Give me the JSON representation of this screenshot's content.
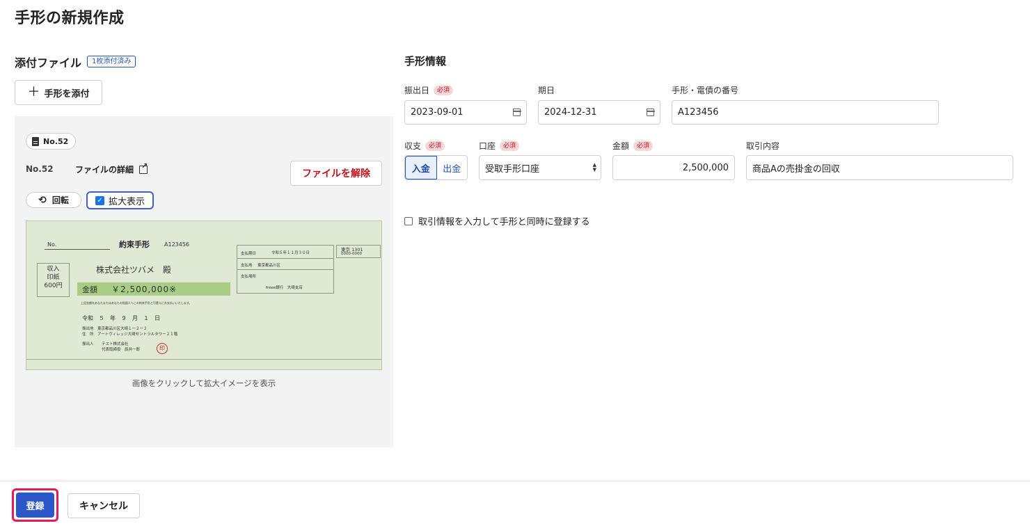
{
  "page": {
    "title": "手形の新規作成"
  },
  "attachments": {
    "section_title": "添付ファイル",
    "badge": "1枚添付済み",
    "attach_button": "手形を添付",
    "file_chip": "No.52",
    "file_no": "No.52",
    "file_detail_link": "ファイルの詳細",
    "remove_button": "ファイルを解除",
    "rotate_button": "回転",
    "zoom_label": "拡大表示",
    "zoom_checked": true,
    "caption": "画像をクリックして拡大イメージを表示",
    "note_image": {
      "no_label": "No.",
      "title": "約束手形",
      "number": "A123456",
      "payee": "株式会社ツバメ　殿",
      "stamp_box": [
        "収入",
        "印紙",
        "600円"
      ],
      "amount_label": "金額",
      "amount": "￥2,500,000※",
      "fine_print": "上記金額をあなたまたはあなたの指図人へこの約束手形と引替えにお支払いいたします。",
      "date_line": "令和　５　年　９　月　１　日",
      "issue_place": "振出地　東京都品川区大崎１ー２ー２",
      "address": "住　所　アートヴィレッジ大崎セントラルタワー２１階",
      "issuer_label": "振出人",
      "issuer": "テスト株式会社",
      "representative": "代表取締役　辰井一郎",
      "seal": "印",
      "due_label": "支払期日",
      "due_date": "令和５年１１月３０日",
      "pay_place_label": "支払地",
      "pay_place": "東京都品川区",
      "pay_at_label": "支払場所",
      "bank": "freee銀行　大崎支店",
      "corner_top": "東京 1301",
      "corner_bottom": "0000-0000"
    }
  },
  "form": {
    "section_title": "手形情報",
    "required_badge": "必須",
    "issue_date": {
      "label": "振出日",
      "value": "2023-09-01"
    },
    "due_date": {
      "label": "期日",
      "value": "2024-12-31"
    },
    "note_number": {
      "label": "手形・電債の番号",
      "value": "A123456"
    },
    "direction": {
      "label": "収支",
      "options": [
        "入金",
        "出金"
      ],
      "selected": "入金"
    },
    "account": {
      "label": "口座",
      "value": "受取手形口座"
    },
    "amount": {
      "label": "金額",
      "value": "2,500,000"
    },
    "description": {
      "label": "取引内容",
      "value": "商品Aの売掛金の回収"
    },
    "register_transaction_checkbox": "取引情報を入力して手形と同時に登録する"
  },
  "footer": {
    "register_button": "登録",
    "cancel_button": "キャンセル"
  },
  "colors": {
    "accent": "#2d57c8",
    "danger": "#c3141b",
    "highlight_border": "#e8185c",
    "note_background": "#dfe9d3",
    "amount_band": "#a9cd85"
  }
}
